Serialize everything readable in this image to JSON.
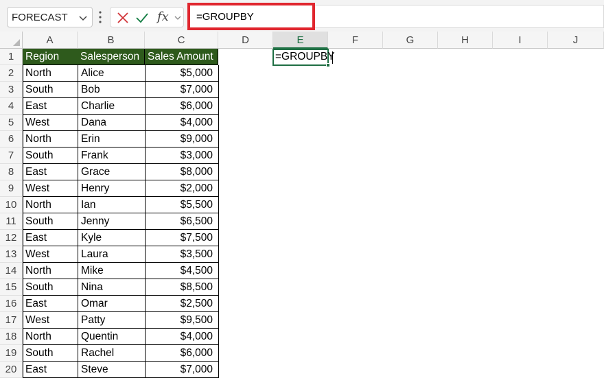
{
  "name_box": {
    "value": "FORECAST"
  },
  "formula_bar": {
    "value": "=GROUPBY",
    "fx_label": "fx"
  },
  "columns": [
    "A",
    "B",
    "C",
    "D",
    "E",
    "F",
    "G",
    "H",
    "I",
    "J"
  ],
  "selected_column": "E",
  "rows": [
    "1",
    "2",
    "3",
    "4",
    "5",
    "6",
    "7",
    "8",
    "9",
    "10",
    "11",
    "12",
    "13",
    "14",
    "15",
    "16",
    "17",
    "18",
    "19",
    "20"
  ],
  "table": {
    "headers": [
      "Region",
      "Salesperson",
      "Sales Amount"
    ],
    "rows": [
      [
        "North",
        "Alice",
        "$5,000"
      ],
      [
        "South",
        "Bob",
        "$7,000"
      ],
      [
        "East",
        "Charlie",
        "$6,000"
      ],
      [
        "West",
        "Dana",
        "$4,000"
      ],
      [
        "North",
        "Erin",
        "$9,000"
      ],
      [
        "South",
        "Frank",
        "$3,000"
      ],
      [
        "East",
        "Grace",
        "$8,000"
      ],
      [
        "West",
        "Henry",
        "$2,000"
      ],
      [
        "North",
        "Ian",
        "$5,500"
      ],
      [
        "South",
        "Jenny",
        "$6,500"
      ],
      [
        "East",
        "Kyle",
        "$7,500"
      ],
      [
        "West",
        "Laura",
        "$3,500"
      ],
      [
        "North",
        "Mike",
        "$4,500"
      ],
      [
        "South",
        "Nina",
        "$8,500"
      ],
      [
        "East",
        "Omar",
        "$2,500"
      ],
      [
        "West",
        "Patty",
        "$9,500"
      ],
      [
        "North",
        "Quentin",
        "$4,000"
      ],
      [
        "South",
        "Rachel",
        "$6,000"
      ],
      [
        "East",
        "Steve",
        "$7,000"
      ]
    ]
  },
  "active_cell": {
    "ref": "E1",
    "value": "=GROUPBY"
  },
  "colors": {
    "table_header_bg": "#2e5a1c",
    "highlight": "#e0262e",
    "selection": "#1e6e43",
    "cancel_icon": "#d13438",
    "enter_icon": "#107c41"
  }
}
